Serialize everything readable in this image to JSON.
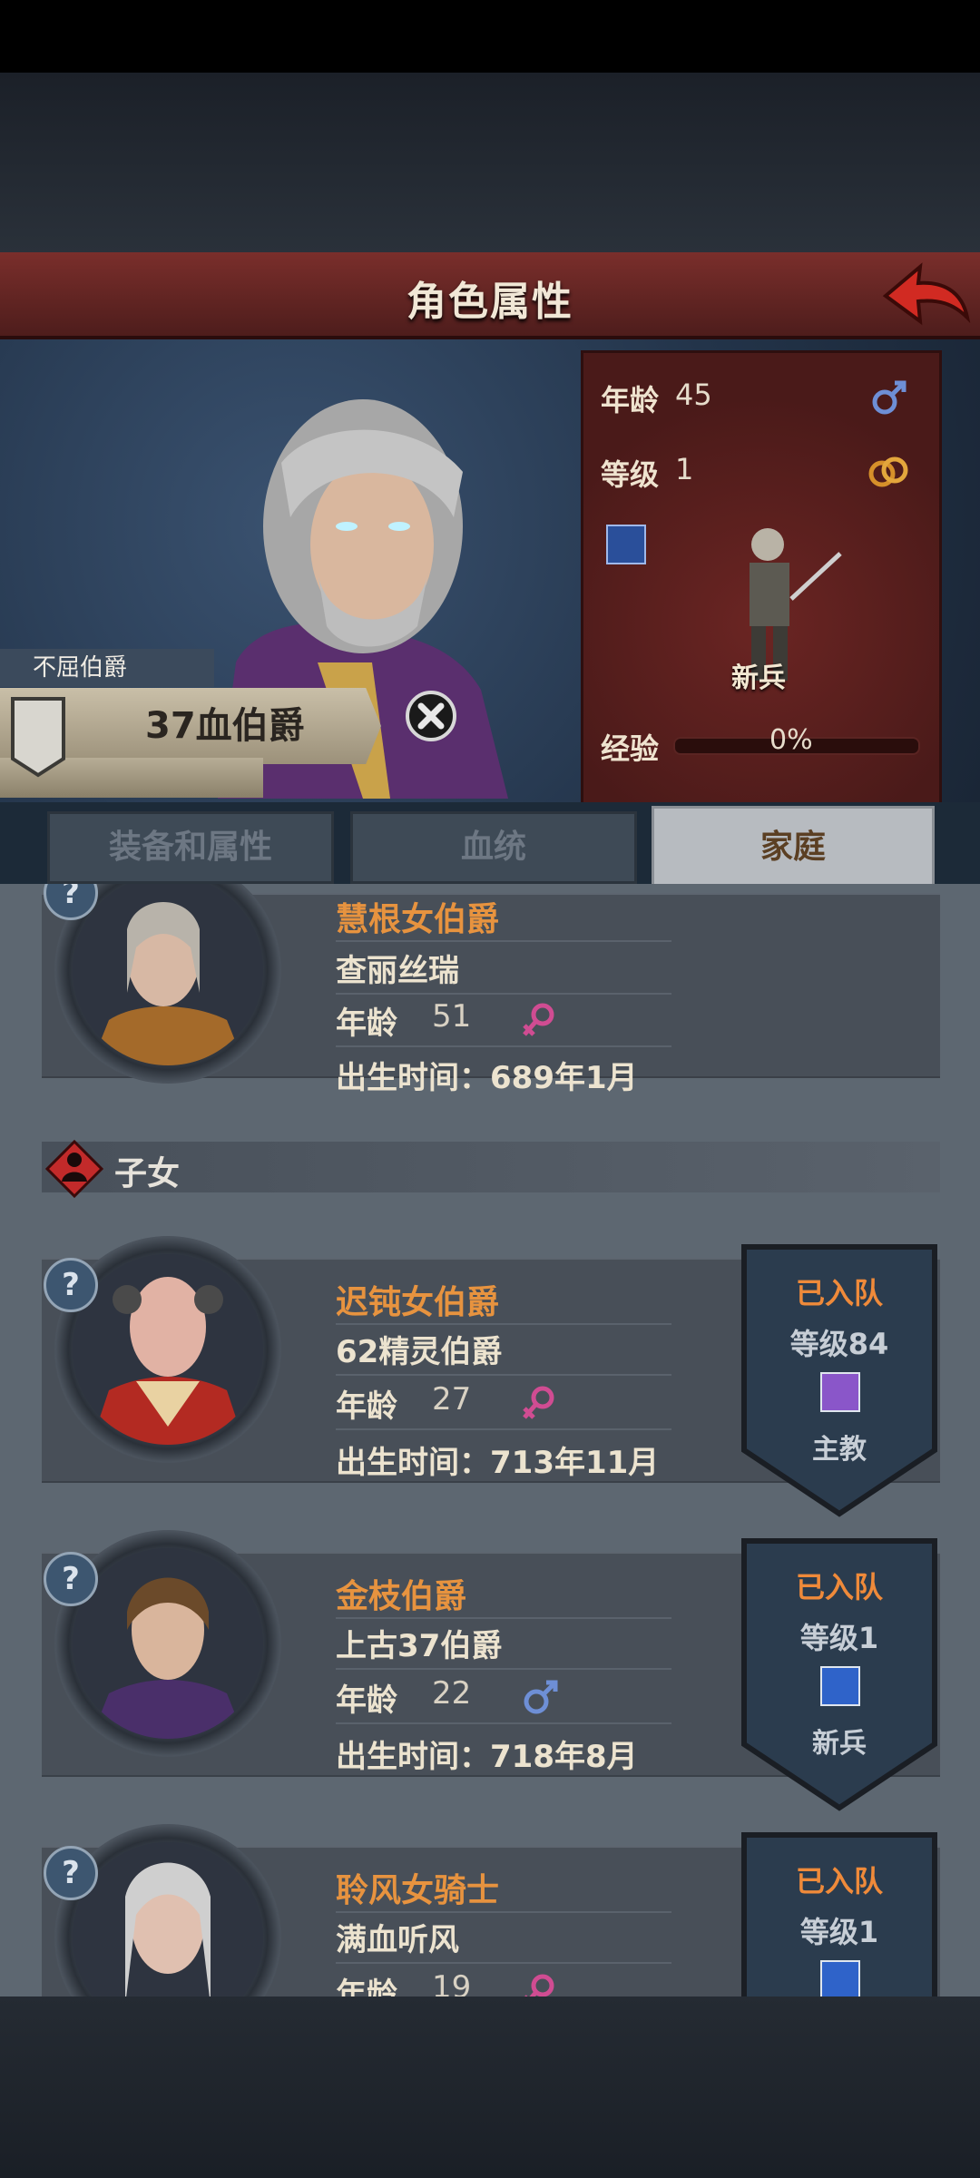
{
  "header": {
    "title": "角色属性"
  },
  "hero": {
    "rank_tag": "不屈伯爵",
    "display_name": "37血伯爵",
    "stats": {
      "age_label": "年龄",
      "age_value": "45",
      "level_label": "等级",
      "level_value": "1",
      "class_name": "新兵",
      "exp_label": "经验",
      "exp_percent": "0%",
      "exp_fraction": 0.0
    }
  },
  "tabs": [
    {
      "label": "装备和属性",
      "active": false
    },
    {
      "label": "血统",
      "active": false
    },
    {
      "label": "家庭",
      "active": true
    }
  ],
  "spouse": {
    "title": "慧根女伯爵",
    "name": "查丽丝瑞",
    "age_label": "年龄",
    "age": "51",
    "gender": "female",
    "birth": "出生时间：689年1月"
  },
  "children_section": {
    "label": "子女"
  },
  "children": [
    {
      "title": "迟钝女伯爵",
      "name": "62精灵伯爵",
      "age_label": "年龄",
      "age": "27",
      "gender": "female",
      "birth": "出生时间：713年11月",
      "party_status": "已入队",
      "level": "等级84",
      "class_name": "主教",
      "class_color": "#8a56c9"
    },
    {
      "title": "金枝伯爵",
      "name": "上古37伯爵",
      "age_label": "年龄",
      "age": "22",
      "gender": "male",
      "birth": "出生时间：718年8月",
      "party_status": "已入队",
      "level": "等级1",
      "class_name": "新兵",
      "class_color": "#2f63c9"
    },
    {
      "title": "聆风女骑士",
      "name": "满血听风",
      "age_label": "年龄",
      "age": "19",
      "gender": "female",
      "party_status": "已入队",
      "level": "等级1",
      "class_color": "#2f63c9"
    }
  ],
  "icons": {
    "help": "?",
    "male_color": "#6e8fd6",
    "female_color": "#d04c92"
  }
}
